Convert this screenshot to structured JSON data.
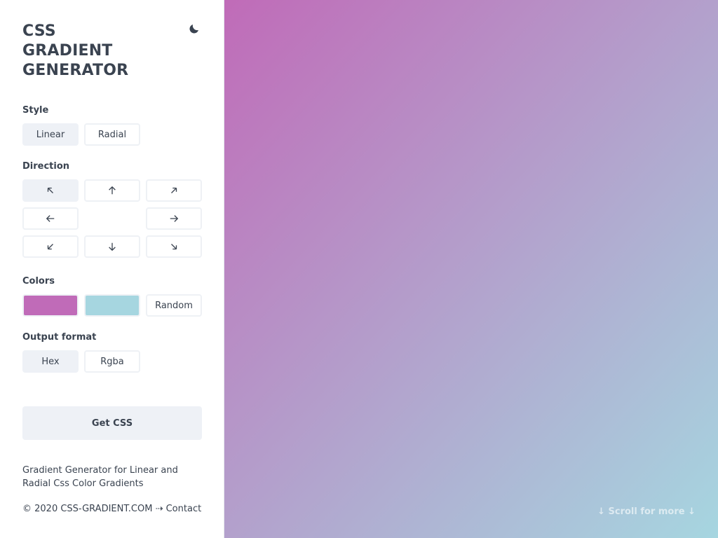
{
  "app": {
    "title_lines": [
      "CSS",
      "GRADIENT",
      "GENERATOR"
    ],
    "theme_toggle_icon": "moon-icon"
  },
  "style": {
    "label": "Style",
    "options": [
      "Linear",
      "Radial"
    ],
    "selected": "Linear"
  },
  "direction": {
    "label": "Direction",
    "arrows": {
      "top_left": "arrow-up-left-icon",
      "top": "arrow-up-icon",
      "top_right": "arrow-up-right-icon",
      "left": "arrow-left-icon",
      "right": "arrow-right-icon",
      "bottom_left": "arrow-down-left-icon",
      "bottom": "arrow-down-icon",
      "bottom_right": "arrow-down-right-icon"
    },
    "selected": "top_left"
  },
  "colors": {
    "label": "Colors",
    "color1": "#c06bb8",
    "color2": "#a6d6e0",
    "random_label": "Random"
  },
  "output_format": {
    "label": "Output format",
    "options": [
      "Hex",
      "Rgba"
    ],
    "selected": "Hex"
  },
  "get_css_label": "Get CSS",
  "description": "Gradient Generator for Linear and Radial Css Color Gradients",
  "footer": {
    "copyright": "© 2020 CSS-GRADIENT.COM",
    "separator": "⇢",
    "contact": "Contact"
  },
  "scroll_hint": "↓ Scroll for more ↓",
  "accent_colors": {
    "text": "#3a4350",
    "button_bg": "#eef1f6",
    "border": "#eef1f5"
  }
}
